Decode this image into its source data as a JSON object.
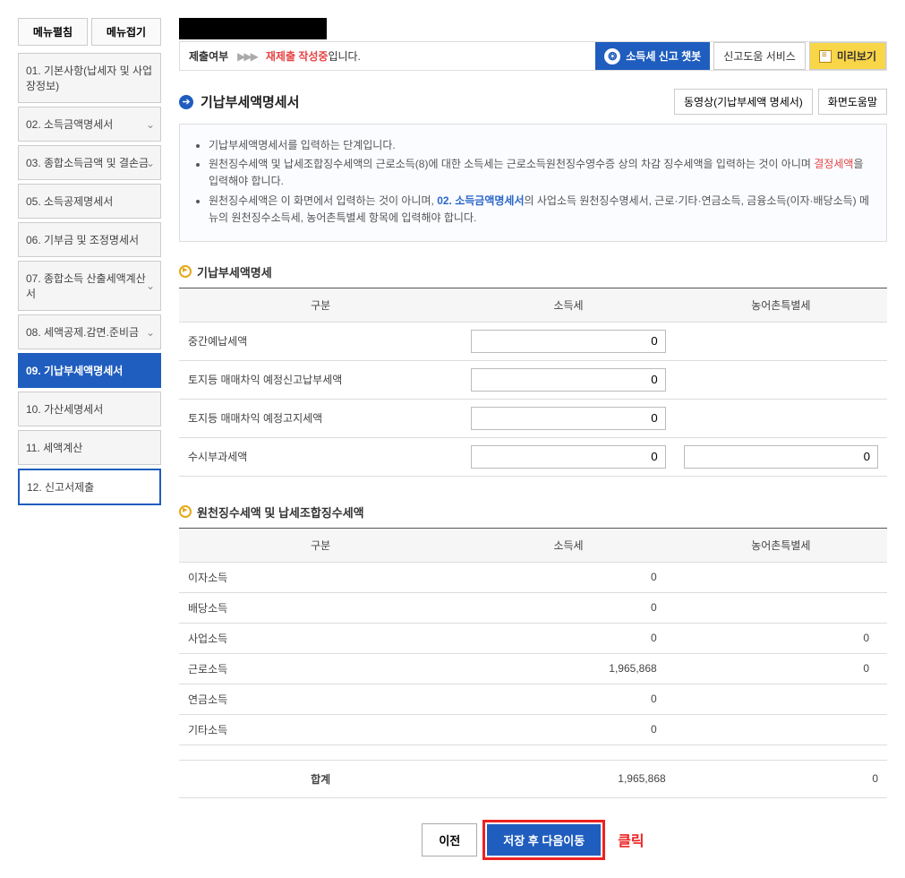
{
  "sidebar": {
    "btn_expand": "메뉴펼침",
    "btn_collapse": "메뉴접기",
    "items": [
      {
        "label": "01. 기본사항(납세자 및 사업장정보)",
        "dropdown": false
      },
      {
        "label": "02. 소득금액명세서",
        "dropdown": true
      },
      {
        "label": "03. 종합소득금액 및 결손금",
        "dropdown": true
      },
      {
        "label": "05. 소득공제명세서",
        "dropdown": false
      },
      {
        "label": "06. 기부금 및 조정명세서",
        "dropdown": false
      },
      {
        "label": "07. 종합소득 산출세액계산서",
        "dropdown": true
      },
      {
        "label": "08. 세액공제.감면.준비금",
        "dropdown": true
      },
      {
        "label": "09. 기납부세액명세서",
        "dropdown": false
      },
      {
        "label": "10. 가산세명세서",
        "dropdown": false
      },
      {
        "label": "11. 세액계산",
        "dropdown": false
      },
      {
        "label": "12. 신고서제출",
        "dropdown": false
      }
    ]
  },
  "header": {
    "submit_label": "제출여부",
    "arrows": "▶▶▶",
    "status_red": "재제출 작성중",
    "status_suffix": "입니다.",
    "chat_btn": "소득세 신고 챗봇",
    "help_btn": "신고도움 서비스",
    "preview_btn": "미리보기"
  },
  "page": {
    "title": "기납부세액명세서",
    "video_btn": "동영상(기납부세액 명세서)",
    "help_btn": "화면도움말"
  },
  "info": {
    "line1": "기납부세액명세서를 입력하는 단계입니다.",
    "line2_a": "원천징수세액 및 납세조합징수세액의 근로소득(8)에 대한 소득세는 근로소득원천징수영수증 상의 차감 징수세액을 입력하는 것이 아니며 ",
    "line2_red": "결정세액",
    "line2_b": "을 입력해야 합니다.",
    "line3_a": "원천징수세액은 이 화면에서 입력하는 것이 아니며, ",
    "line3_blue": "02. 소득금액명세서",
    "line3_b": "의 사업소득 원천징수명세서, 근로·기타·연금소득, 금융소득(이자·배당소득) 메뉴의 원천징수소득세, 농어촌특별세 항목에 입력해야 합니다."
  },
  "section1": {
    "title": "기납부세액명세",
    "cols": {
      "c1": "구분",
      "c2": "소득세",
      "c3": "농어촌특별세"
    },
    "rows": [
      {
        "label": "중간예납세액",
        "v1": "0",
        "v2": null
      },
      {
        "label": "토지등 매매차익 예정신고납부세액",
        "v1": "0",
        "v2": null
      },
      {
        "label": "토지등 매매차익 예정고지세액",
        "v1": "0",
        "v2": null
      },
      {
        "label": "수시부과세액",
        "v1": "0",
        "v2": "0"
      }
    ]
  },
  "section2": {
    "title": "원천징수세액 및 납세조합징수세액",
    "cols": {
      "c1": "구분",
      "c2": "소득세",
      "c3": "농어촌특별세"
    },
    "rows": [
      {
        "label": "이자소득",
        "v1": "0",
        "v2": ""
      },
      {
        "label": "배당소득",
        "v1": "0",
        "v2": ""
      },
      {
        "label": "사업소득",
        "v1": "0",
        "v2": "0"
      },
      {
        "label": "근로소득",
        "v1": "1,965,868",
        "v2": "0"
      },
      {
        "label": "연금소득",
        "v1": "0",
        "v2": ""
      },
      {
        "label": "기타소득",
        "v1": "0",
        "v2": ""
      }
    ],
    "total": {
      "label": "합계",
      "v1": "1,965,868",
      "v2": "0"
    }
  },
  "buttons": {
    "prev": "이전",
    "next": "저장 후 다음이동",
    "click": "클릭"
  }
}
